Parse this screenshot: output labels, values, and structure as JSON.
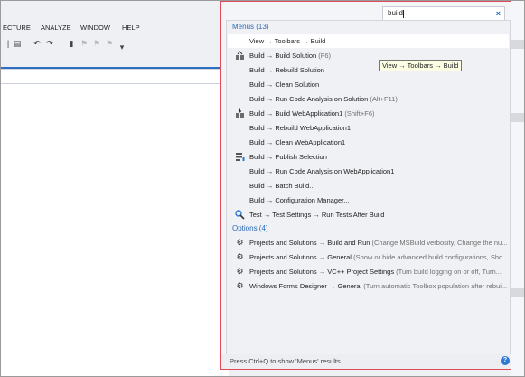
{
  "menubar": {
    "items": [
      "ECTURE",
      "ANALYZE",
      "WINDOW",
      "HELP"
    ]
  },
  "search": {
    "value": "build",
    "close_glyph": "×"
  },
  "groups": {
    "menus_header": "Menus (13)",
    "options_header": "Options (4)"
  },
  "menus": [
    {
      "icon": "",
      "text": "View → Toolbars → Build",
      "hint": ""
    },
    {
      "icon": "build-solution-icon",
      "text": "Build → Build Solution",
      "hint": " (F6)"
    },
    {
      "icon": "",
      "text": "Build → Rebuild Solution",
      "hint": ""
    },
    {
      "icon": "",
      "text": "Build → Clean Solution",
      "hint": ""
    },
    {
      "icon": "",
      "text": "Build → Run Code Analysis on Solution",
      "hint": " (Alt+F11)"
    },
    {
      "icon": "build-project-icon",
      "text": "Build → Build WebApplication1",
      "hint": " (Shift+F6)"
    },
    {
      "icon": "",
      "text": "Build → Rebuild WebApplication1",
      "hint": ""
    },
    {
      "icon": "",
      "text": "Build → Clean WebApplication1",
      "hint": ""
    },
    {
      "icon": "publish-icon",
      "text": "Build → Publish Selection",
      "hint": ""
    },
    {
      "icon": "",
      "text": "Build → Run Code Analysis on WebApplication1",
      "hint": ""
    },
    {
      "icon": "",
      "text": "Build → Batch Build...",
      "hint": ""
    },
    {
      "icon": "",
      "text": "Build → Configuration Manager...",
      "hint": ""
    },
    {
      "icon": "test-settings-icon",
      "text": "Test → Test Settings → Run Tests After Build",
      "hint": ""
    }
  ],
  "options": [
    {
      "text": "Projects and Solutions → Build and Run",
      "hint": " (Change MSBuild verbosity, Change the nu..."
    },
    {
      "text": "Projects and Solutions → General",
      "hint": " (Show or hide advanced build configurations, Sho..."
    },
    {
      "text": "Projects and Solutions → VC++ Project Settings",
      "hint": " (Turn build logging on or off, Turn..."
    },
    {
      "text": "Windows Forms Designer → General",
      "hint": " (Turn automatic Toolbox population after rebui..."
    }
  ],
  "tooltip": "View → Toolbars → Build",
  "status": "Press Ctrl+Q to show 'Menus' results.",
  "colors": {
    "accent": "#2a6ab5",
    "popup_border": "#e04b59",
    "ide_blue": "#2f6fc0"
  }
}
